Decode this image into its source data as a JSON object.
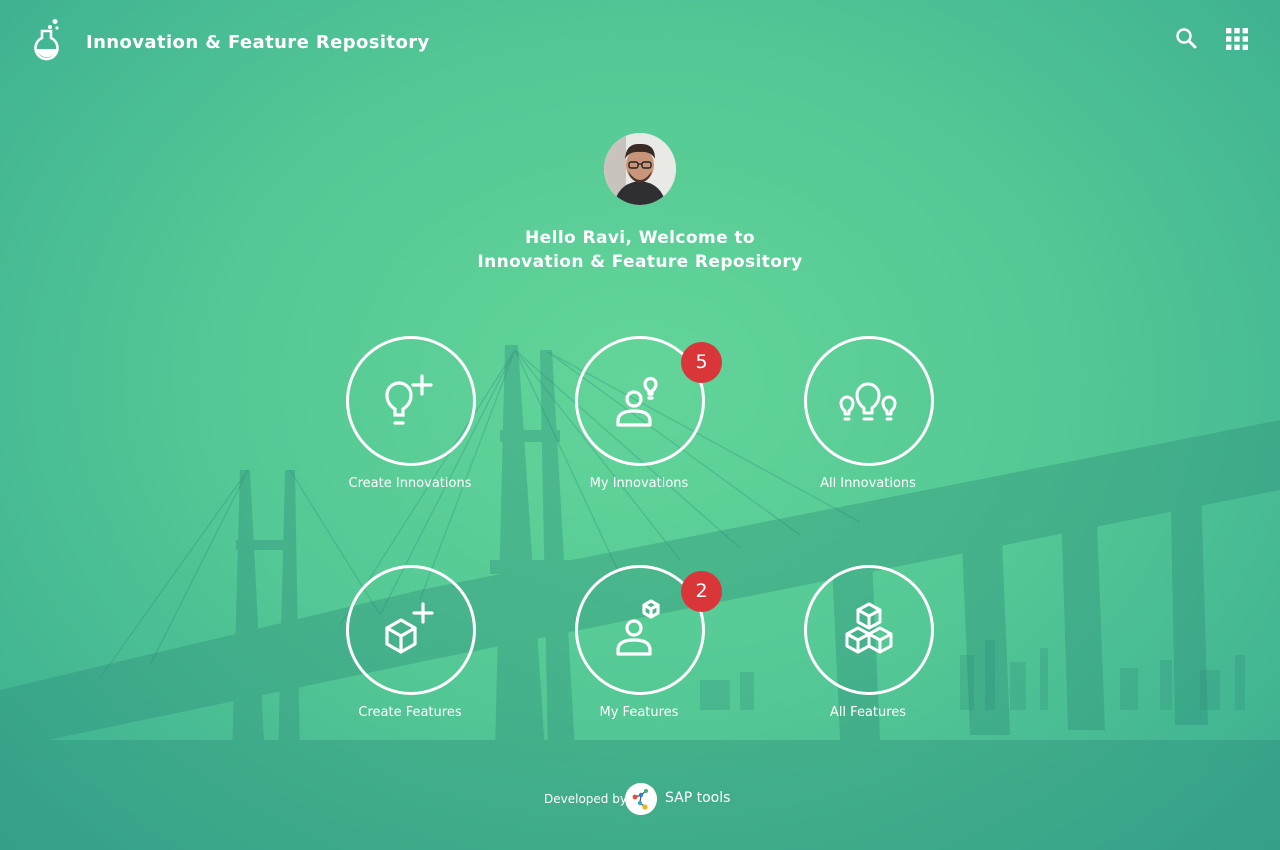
{
  "header": {
    "title": "Innovation & Feature Repository",
    "logo_icon": "flask-icon",
    "search_icon": "search-icon",
    "apps_icon": "app-grid-icon"
  },
  "welcome": {
    "line1": "Hello Ravi, Welcome to",
    "line2": "Innovation & Feature Repository"
  },
  "tiles": [
    {
      "label": "Create Innovations",
      "icon": "lightbulb-plus-icon"
    },
    {
      "label": "My Innovations",
      "icon": "user-lightbulb-icon",
      "badge": "5"
    },
    {
      "label": "All Innovations",
      "icon": "lightbulbs-icon"
    },
    {
      "label": "Create Features",
      "icon": "cube-plus-icon"
    },
    {
      "label": "My Features",
      "icon": "user-cube-icon",
      "badge": "2"
    },
    {
      "label": "All Features",
      "icon": "cubes-icon"
    }
  ],
  "footer": {
    "developed_by": "Developed by",
    "brand": "SAP tools",
    "brand_icon": "sap-tools-logo"
  },
  "colors": {
    "accent": "#5bcf9a",
    "badge": "#d9363a"
  }
}
